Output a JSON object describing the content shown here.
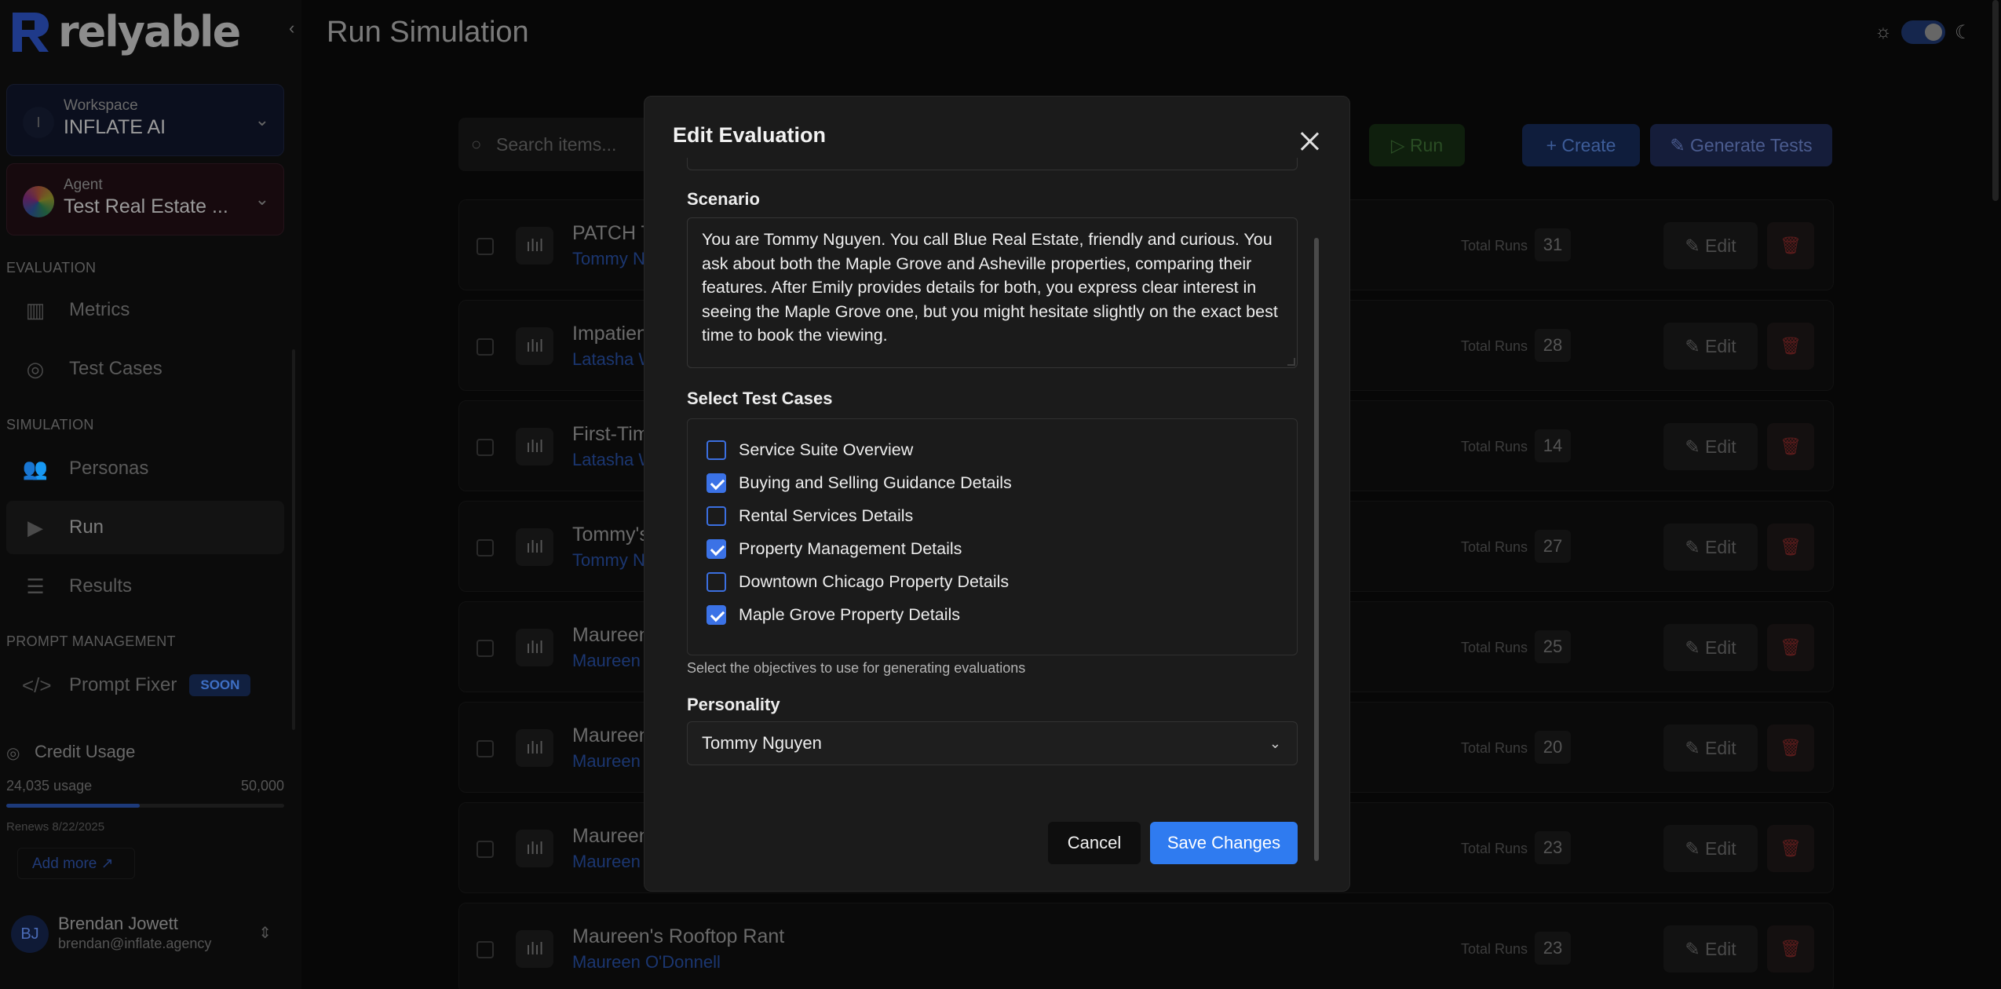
{
  "app": {
    "brand": "relyable",
    "page_title": "Run Simulation"
  },
  "sidebar": {
    "workspace": {
      "label": "Workspace",
      "name": "INFLATE AI"
    },
    "agent": {
      "label": "Agent",
      "name": "Test Real Estate ..."
    },
    "sections": {
      "evaluation": "EVALUATION",
      "simulation": "SIMULATION",
      "prompt_management": "PROMPT MANAGEMENT"
    },
    "items": {
      "metrics": "Metrics",
      "test_cases": "Test Cases",
      "personas": "Personas",
      "run": "Run",
      "results": "Results",
      "prompt_fixer": "Prompt Fixer",
      "soon_badge": "SOON"
    },
    "credit": {
      "title": "Credit Usage",
      "usage": "24,035 usage",
      "limit": "50,000",
      "usage_fraction": 0.48,
      "renews": "Renews 8/22/2025",
      "add_more": "Add more"
    },
    "user": {
      "initials": "BJ",
      "name": "Brendan Jowett",
      "email": "brendan@inflate.agency"
    }
  },
  "toolbar": {
    "search_placeholder": "Search items...",
    "run": "Run",
    "create": "Create",
    "generate": "Generate Tests"
  },
  "rows": [
    {
      "title": "PATCH T",
      "sub": "Tommy N",
      "runs_label": "Total Runs",
      "runs": "31",
      "edit": "Edit"
    },
    {
      "title": "Impatien",
      "sub": "Latasha W",
      "runs_label": "Total Runs",
      "runs": "28",
      "edit": "Edit"
    },
    {
      "title": "First-Tim",
      "sub": "Latasha W",
      "runs_label": "Total Runs",
      "runs": "14",
      "edit": "Edit"
    },
    {
      "title": "Tommy's",
      "sub": "Tommy N",
      "runs_label": "Total Runs",
      "runs": "27",
      "edit": "Edit"
    },
    {
      "title": "Maureen",
      "sub": "Maureen",
      "runs_label": "Total Runs",
      "runs": "25",
      "edit": "Edit"
    },
    {
      "title": "Maureen",
      "sub": "Maureen",
      "runs_label": "Total Runs",
      "runs": "20",
      "edit": "Edit"
    },
    {
      "title": "Maureen",
      "sub": "Maureen",
      "runs_label": "Total Runs",
      "runs": "23",
      "edit": "Edit"
    },
    {
      "title": "Maureen's Rooftop Rant",
      "sub": "Maureen O'Donnell",
      "runs_label": "Total Runs",
      "runs": "23",
      "edit": "Edit"
    }
  ],
  "modal": {
    "title": "Edit Evaluation",
    "scenario_label": "Scenario",
    "scenario_text": "You are Tommy Nguyen. You call Blue Real Estate, friendly and curious. You ask about both the Maple Grove and Asheville properties, comparing their features. After Emily provides details for both, you express clear interest in seeing the Maple Grove one, but you might hesitate slightly on the exact best time to book the viewing.",
    "test_cases_label": "Select Test Cases",
    "test_cases": [
      {
        "label": "Service Suite Overview",
        "checked": false
      },
      {
        "label": "Buying and Selling Guidance Details",
        "checked": true
      },
      {
        "label": "Rental Services Details",
        "checked": false
      },
      {
        "label": "Property Management Details",
        "checked": true
      },
      {
        "label": "Downtown Chicago Property Details",
        "checked": false
      },
      {
        "label": "Maple Grove Property Details",
        "checked": true
      }
    ],
    "hint": "Select the objectives to use for generating evaluations",
    "personality_label": "Personality",
    "personality_value": "Tommy Nguyen",
    "cancel": "Cancel",
    "save": "Save Changes"
  }
}
